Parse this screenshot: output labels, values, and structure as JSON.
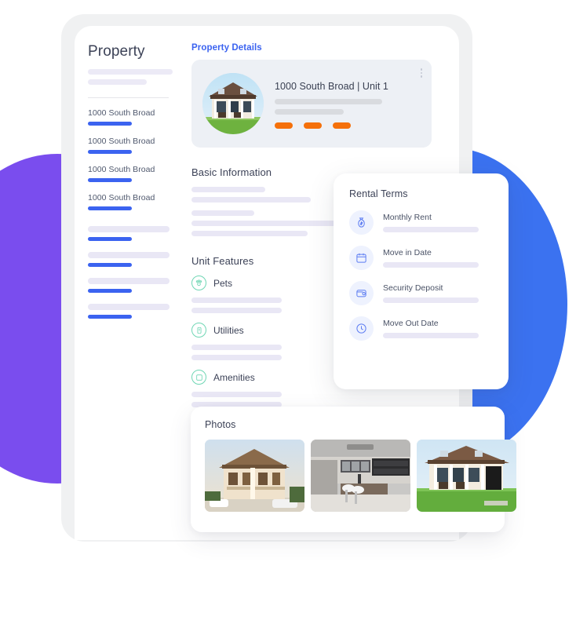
{
  "sidebar": {
    "title": "Property",
    "items": [
      {
        "label": "1000 South Broad"
      },
      {
        "label": "1000 South Broad"
      },
      {
        "label": "1000 South Broad"
      },
      {
        "label": "1000 South Broad"
      }
    ],
    "skeleton_items": 4
  },
  "main": {
    "section_link": "Property Details",
    "property_card": {
      "title": "1000 South Broad | Unit 1",
      "menu_icon": "more-vertical-icon",
      "badge_count": 3,
      "badge_color": "#f5700a"
    },
    "basic_information": {
      "heading": "Basic Information",
      "skeleton_rows": [
        94,
        152,
        80,
        188,
        148
      ]
    },
    "unit_features": {
      "heading": "Unit Features",
      "items": [
        {
          "label": "Pets",
          "icon": "paw-icon"
        },
        {
          "label": "Utilities",
          "icon": "utilities-icon"
        },
        {
          "label": "Amenities",
          "icon": "amenities-icon"
        }
      ]
    }
  },
  "rental_terms": {
    "title": "Rental Terms",
    "items": [
      {
        "label": "Monthly Rent",
        "icon": "money-bag-icon"
      },
      {
        "label": "Move in Date",
        "icon": "calendar-icon"
      },
      {
        "label": "Security Deposit",
        "icon": "wallet-icon"
      },
      {
        "label": "Move Out Date",
        "icon": "clock-icon"
      }
    ]
  },
  "photos": {
    "title": "Photos",
    "items": [
      {
        "alt": "house-exterior-photo"
      },
      {
        "alt": "kitchen-interior-photo"
      },
      {
        "alt": "house-front-lawn-photo"
      }
    ]
  },
  "theme": {
    "accent_blue": "#3b63f0",
    "decor_purple": "#7a4dee",
    "decor_blue": "#3b72f0",
    "badge_orange": "#f5700a",
    "feature_green": "#6fd6b4"
  }
}
